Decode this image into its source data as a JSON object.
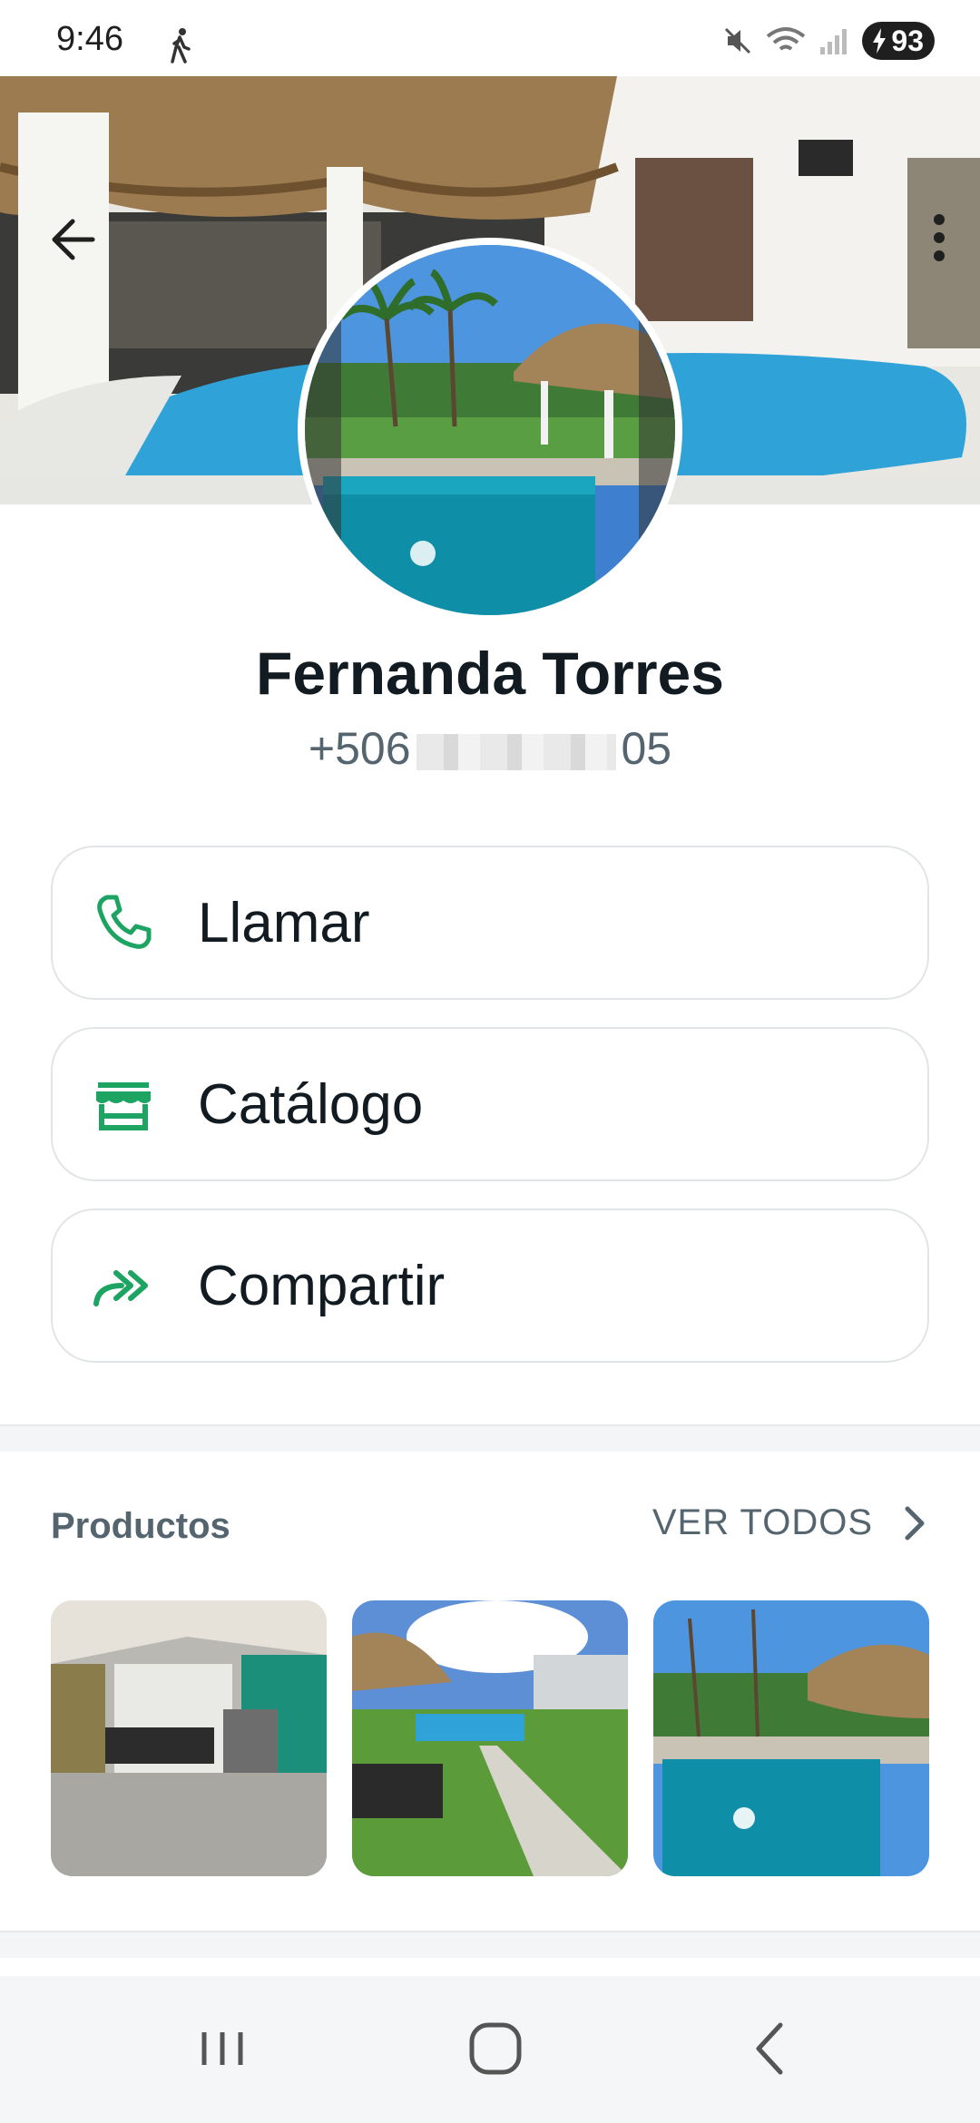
{
  "status_bar": {
    "time": "9:46",
    "battery": "93",
    "icons": [
      "walk-icon",
      "mute-icon",
      "wifi-icon",
      "signal-icon",
      "charging-icon"
    ]
  },
  "profile": {
    "name": "Fernanda Torres",
    "phone_prefix": "+506",
    "phone_suffix": "05"
  },
  "actions": [
    {
      "label": "Llamar",
      "icon": "phone-icon"
    },
    {
      "label": "Catálogo",
      "icon": "store-icon"
    },
    {
      "label": "Compartir",
      "icon": "forward-icon"
    }
  ],
  "products": {
    "title": "Productos",
    "see_all": "VER TODOS"
  },
  "colors": {
    "accent": "#1DA462",
    "text_primary": "#111b21",
    "text_secondary": "#54656f",
    "pool_blue": "#2fa3d8"
  },
  "navbar": [
    "recent-apps-icon",
    "home-icon",
    "back-icon"
  ]
}
